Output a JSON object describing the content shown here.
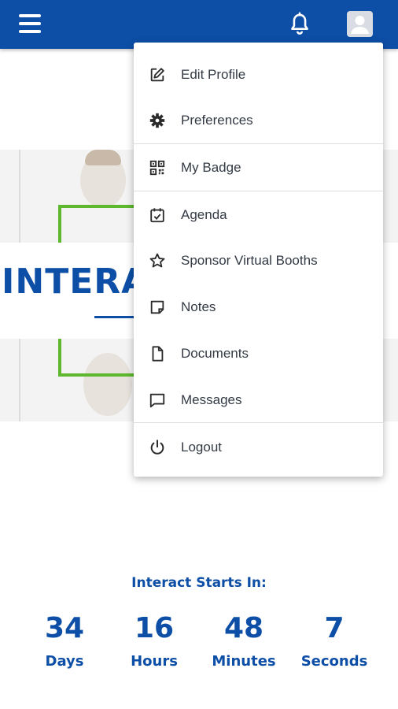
{
  "header": {
    "menu_icon": "hamburger-menu-icon",
    "notification_icon": "bell-icon",
    "profile_icon": "user-avatar-icon",
    "bar_color": "#0d4ea6"
  },
  "hero": {
    "title": "INTERACT VIRTUAL",
    "accent_color": "#5db82e"
  },
  "profile_menu": {
    "items": [
      {
        "label": "Edit Profile",
        "icon": "edit-icon"
      },
      {
        "label": "Preferences",
        "icon": "gear-icon"
      },
      {
        "label": "My Badge",
        "icon": "qr-code-icon"
      },
      {
        "label": "Agenda",
        "icon": "calendar-check-icon"
      },
      {
        "label": "Sponsor Virtual Booths",
        "icon": "star-icon"
      },
      {
        "label": "Notes",
        "icon": "note-icon"
      },
      {
        "label": "Documents",
        "icon": "document-icon"
      },
      {
        "label": "Messages",
        "icon": "chat-bubble-icon"
      },
      {
        "label": "Logout",
        "icon": "power-icon"
      }
    ]
  },
  "countdown": {
    "title": "Interact Starts In:",
    "units": [
      {
        "value": "34",
        "label": "Days"
      },
      {
        "value": "16",
        "label": "Hours"
      },
      {
        "value": "48",
        "label": "Minutes"
      },
      {
        "value": "7",
        "label": "Seconds"
      }
    ]
  }
}
